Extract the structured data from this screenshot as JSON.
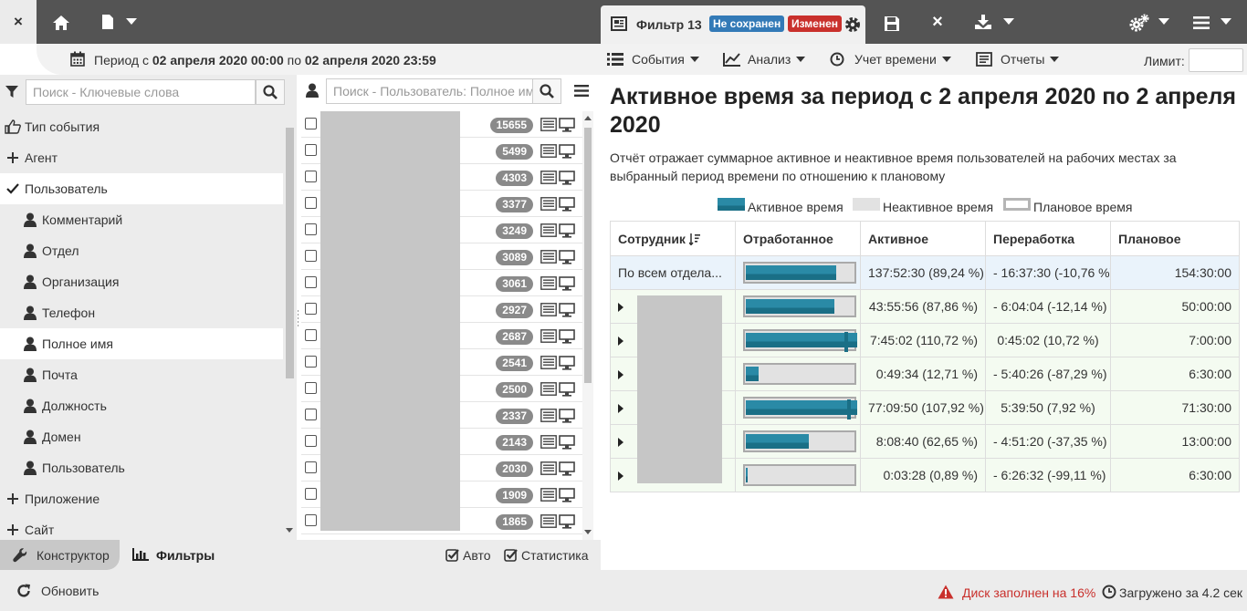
{
  "toolbar": {
    "close_label": "×",
    "filter_tab_title": "Фильтр 13",
    "badge_unsaved": "Не сохранен",
    "badge_changed": "Изменен",
    "close_filter_label": "×"
  },
  "period": {
    "prefix": "Период с",
    "from": "02 апреля 2020 00:00",
    "middle": "по",
    "to": "02 апреля 2020 23:59"
  },
  "menu": {
    "events": "События",
    "analysis": "Анализ",
    "time_tracking": "Учет времени",
    "reports": "Отчеты",
    "limit_label": "Лимит:"
  },
  "left_panel": {
    "search_placeholder": "Поиск - Ключевые слова",
    "items": [
      {
        "label": "Тип события",
        "icon": "thumb-icon"
      },
      {
        "label": "Агент",
        "icon": "plus-icon"
      },
      {
        "label": "Пользователь",
        "icon": "check-icon"
      },
      {
        "label": "Комментарий",
        "icon": "user-icon"
      },
      {
        "label": "Отдел",
        "icon": "user-icon"
      },
      {
        "label": "Организация",
        "icon": "user-icon"
      },
      {
        "label": "Телефон",
        "icon": "user-icon"
      },
      {
        "label": "Полное имя",
        "icon": "user-icon",
        "suffix": "✓"
      },
      {
        "label": "Почта",
        "icon": "user-icon"
      },
      {
        "label": "Должность",
        "icon": "user-icon"
      },
      {
        "label": "Домен",
        "icon": "user-icon"
      },
      {
        "label": "Пользователь",
        "icon": "user-icon"
      },
      {
        "label": "Приложение",
        "icon": "plus-icon"
      },
      {
        "label": "Сайт",
        "icon": "plus-icon"
      }
    ]
  },
  "mid_panel": {
    "search_placeholder": "Поиск - Пользователь: Полное имя",
    "counts": [
      "15655",
      "5499",
      "4303",
      "3377",
      "3249",
      "3089",
      "3061",
      "2927",
      "2687",
      "2541",
      "2500",
      "2337",
      "2143",
      "2030",
      "1909",
      "1865"
    ]
  },
  "bottom_tabs": {
    "constructor": "Конструктор",
    "filters": "Фильтры",
    "auto": "Авто",
    "statistics": "Статистика"
  },
  "status": {
    "refresh": "Обновить",
    "disk": "Диск заполнен на 16%",
    "loaded": "Загружено за 4.2 сек"
  },
  "report": {
    "title": "Активное время за период с 2 апреля 2020 по 2 апреля 2020",
    "description": "Отчёт отражает суммарное активное и неактивное время пользователей на рабочих местах за выбранный период времени по отношению к плановому",
    "legend": {
      "active": "Активное время",
      "inactive": "Неактивное время",
      "planned": "Плановое время"
    },
    "columns": [
      "Сотрудник",
      "Отработанное",
      "Активное",
      "Переработка",
      "Плановое"
    ],
    "summary": {
      "employee": "По всем отдела...",
      "bar": 0.8924,
      "active": "137:52:30 (89,24 %)",
      "overtime": "- 16:37:30 (-10,76 %)",
      "planned": "154:30:00"
    },
    "rows": [
      {
        "bar": 0.8786,
        "active": "43:55:56 (87,86 %)",
        "overtime": "- 6:04:04 (-12,14 %)",
        "planned": "50:00:00"
      },
      {
        "bar": 1.1072,
        "active": "7:45:02 (110,72 %)",
        "overtime": "0:45:02 (10,72 %)",
        "planned": "7:00:00"
      },
      {
        "bar": 0.1271,
        "active": "0:49:34 (12,71 %)",
        "overtime": "- 5:40:26 (-87,29 %)",
        "planned": "6:30:00"
      },
      {
        "bar": 1.0792,
        "active": "77:09:50 (107,92 %)",
        "overtime": "5:39:50 (7,92 %)",
        "planned": "71:30:00"
      },
      {
        "bar": 0.6265,
        "active": "8:08:40 (62,65 %)",
        "overtime": "- 4:51:20 (-37,35 %)",
        "planned": "13:00:00"
      },
      {
        "bar": 0.0089,
        "active": "0:03:28 (0,89 %)",
        "overtime": "- 6:26:32 (-99,11 %)",
        "planned": "6:30:00"
      }
    ]
  },
  "colors": {
    "accent": "#2a8aa6",
    "unsaved": "#337ab7",
    "changed": "#c9302c",
    "disk_warning": "#c9302c"
  }
}
